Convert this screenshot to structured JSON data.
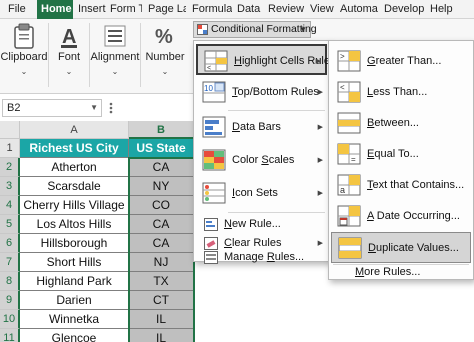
{
  "ribbon": {
    "tabs": [
      "File",
      "Home",
      "Insert",
      "Form Ta",
      "Page La",
      "Formula",
      "Data",
      "Review",
      "View",
      "Automa",
      "Develop",
      "Help"
    ],
    "active_tab": "Home",
    "groups": {
      "clipboard": "Clipboard",
      "font": "Font",
      "alignment": "Alignment",
      "number": "Number"
    },
    "accent_color": "#217346"
  },
  "name_box": {
    "value": "B2"
  },
  "grid": {
    "columns": [
      "A",
      "B"
    ],
    "rows": [
      "1",
      "2",
      "3",
      "4",
      "5",
      "6",
      "7",
      "8",
      "9",
      "10",
      "11"
    ],
    "header": {
      "a": "Richest US City",
      "b": "US State"
    },
    "data": [
      {
        "a": "Atherton",
        "b": "CA"
      },
      {
        "a": "Scarsdale",
        "b": "NY"
      },
      {
        "a": "Cherry Hills Village",
        "b": "CO"
      },
      {
        "a": "Los Altos Hills",
        "b": "CA"
      },
      {
        "a": "Hillsborough",
        "b": "CA"
      },
      {
        "a": "Short Hills",
        "b": "NJ"
      },
      {
        "a": "Highland Park",
        "b": "TX"
      },
      {
        "a": "Darien",
        "b": "CT"
      },
      {
        "a": "Winnetka",
        "b": "IL"
      },
      {
        "a": "Glencoe",
        "b": "IL"
      }
    ],
    "header_color": "#1ba6a6"
  },
  "conditional_formatting": {
    "button_label": "Conditional Formatting",
    "menu": {
      "highlight": {
        "pre": "",
        "ul": "H",
        "post": "ighlight Cells Rules"
      },
      "topbottom": {
        "pre": "",
        "ul": "T",
        "post": "op/Bottom Rules"
      },
      "databars": {
        "pre": "",
        "ul": "D",
        "post": "ata Bars"
      },
      "colorscales": {
        "pre": "Color ",
        "ul": "S",
        "post": "cales"
      },
      "iconsets": {
        "pre": "",
        "ul": "I",
        "post": "con Sets"
      },
      "newrule": {
        "pre": "",
        "ul": "N",
        "post": "ew Rule..."
      },
      "clearrules": {
        "pre": "",
        "ul": "C",
        "post": "lear Rules"
      },
      "managerules": {
        "pre": "Manage ",
        "ul": "R",
        "post": "ules..."
      }
    },
    "submenu": {
      "greaterthan": {
        "pre": "",
        "ul": "G",
        "post": "reater Than..."
      },
      "lessthan": {
        "pre": "",
        "ul": "L",
        "post": "ess Than..."
      },
      "between": {
        "pre": "",
        "ul": "B",
        "post": "etween..."
      },
      "equalto": {
        "pre": "",
        "ul": "E",
        "post": "qual To..."
      },
      "textcontains": {
        "pre": "",
        "ul": "T",
        "post": "ext that Contains..."
      },
      "dateoccurring": {
        "pre": "",
        "ul": "A",
        "post": " Date Occurring..."
      },
      "duplicatevalues": {
        "pre": "",
        "ul": "D",
        "post": "uplicate Values..."
      },
      "morerules": {
        "pre": "",
        "ul": "M",
        "post": "ore Rules..."
      }
    }
  }
}
